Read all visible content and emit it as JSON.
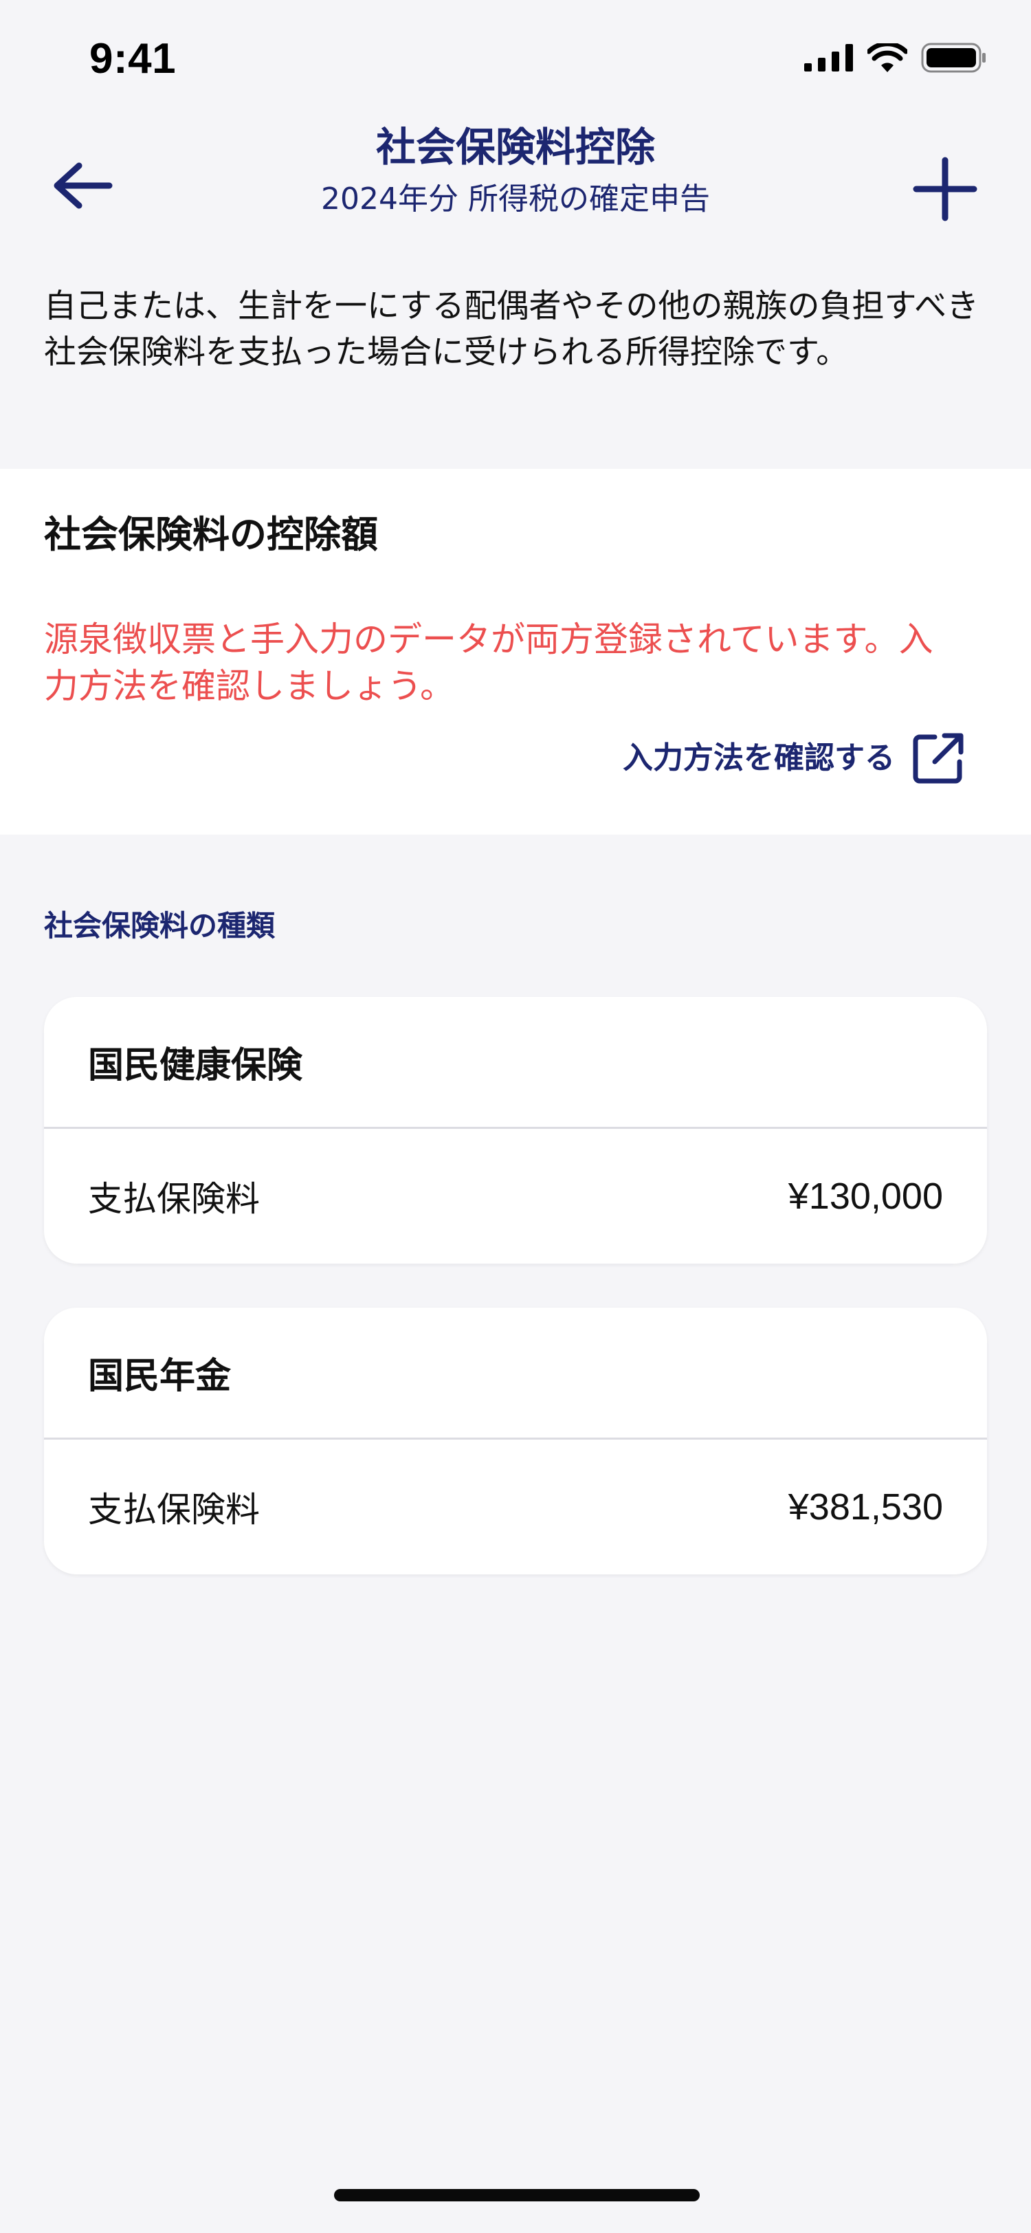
{
  "status_bar": {
    "time": "9:41",
    "icons": [
      "cellular-signal-icon",
      "wifi-icon",
      "battery-icon"
    ]
  },
  "header": {
    "title": "社会保険料控除",
    "subtitle": "2024年分 所得税の確定申告",
    "back_icon": "arrow-left-icon",
    "add_icon": "plus-icon"
  },
  "intro_text": "自己または、生計を一にする配偶者やその他の親族の負担すべき社会保険料を支払った場合に受けられる所得控除です。",
  "deduction": {
    "title": "社会保険料の控除額",
    "warning": "源泉徴収票と手入力のデータが両方登録されています。入力方法を確認しましょう。",
    "link_label": "入力方法を確認する",
    "link_icon": "external-link-icon"
  },
  "section_label": "社会保険料の種類",
  "insurances": [
    {
      "name": "国民健康保険",
      "row_label": "支払保険料",
      "amount": "¥130,000"
    },
    {
      "name": "国民年金",
      "row_label": "支払保険料",
      "amount": "¥381,530"
    }
  ],
  "colors": {
    "navy": "#1c2670",
    "warning_red": "#ec4f4f",
    "background": "#f5f5f8",
    "card": "#ffffff"
  }
}
